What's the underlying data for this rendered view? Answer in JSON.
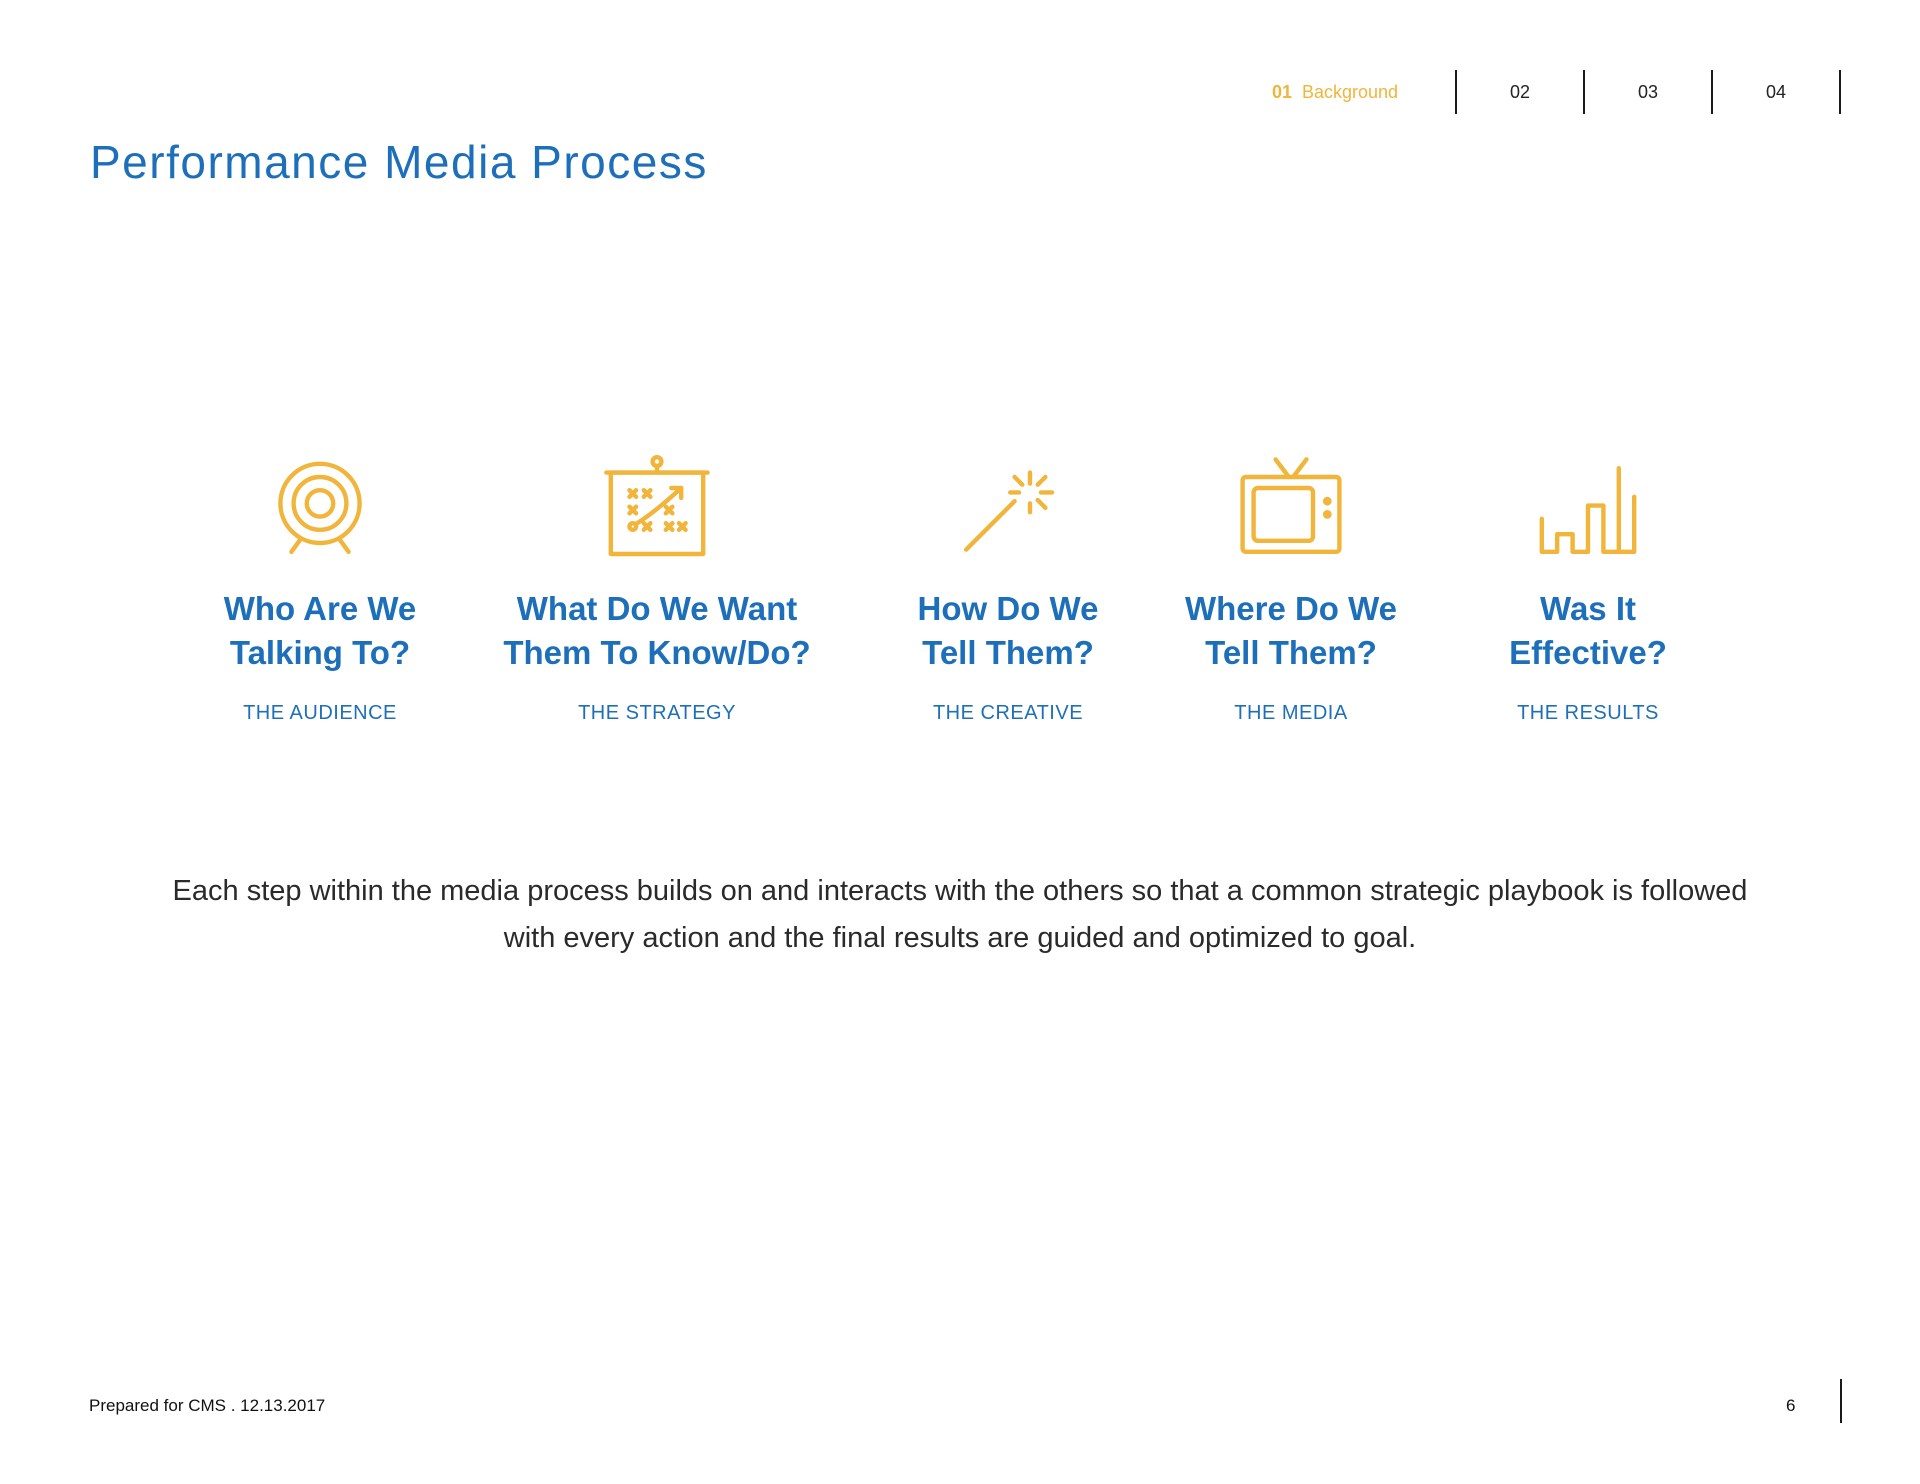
{
  "nav": {
    "items": [
      {
        "num": "01",
        "label": "Background"
      },
      {
        "label": "02"
      },
      {
        "label": "03"
      },
      {
        "label": "04"
      }
    ]
  },
  "page_title": "Performance Media Process",
  "steps": [
    {
      "icon": "target-icon",
      "question": "Who Are We\nTalking To?",
      "subtitle": "THE AUDIENCE"
    },
    {
      "icon": "strategy-board-icon",
      "question": "What Do We Want\nThem To Know/Do?",
      "subtitle": "THE STRATEGY"
    },
    {
      "icon": "magic-wand-icon",
      "question": "How Do We\nTell Them?",
      "subtitle": "THE CREATIVE"
    },
    {
      "icon": "tv-icon",
      "question": "Where Do We\nTell Them?",
      "subtitle": "THE MEDIA"
    },
    {
      "icon": "bar-chart-icon",
      "question": "Was It\nEffective?",
      "subtitle": "THE RESULTS"
    }
  ],
  "description": "Each step within the media process builds on and interacts with the others so that a common strategic playbook is followed with every action and the final results are guided and optimized to goal.",
  "footer": {
    "prepared": "Prepared for CMS . 12.13.2017",
    "page_number": "6"
  },
  "colors": {
    "accent_blue": "#1e6fba",
    "accent_gold": "#f0b53a"
  }
}
